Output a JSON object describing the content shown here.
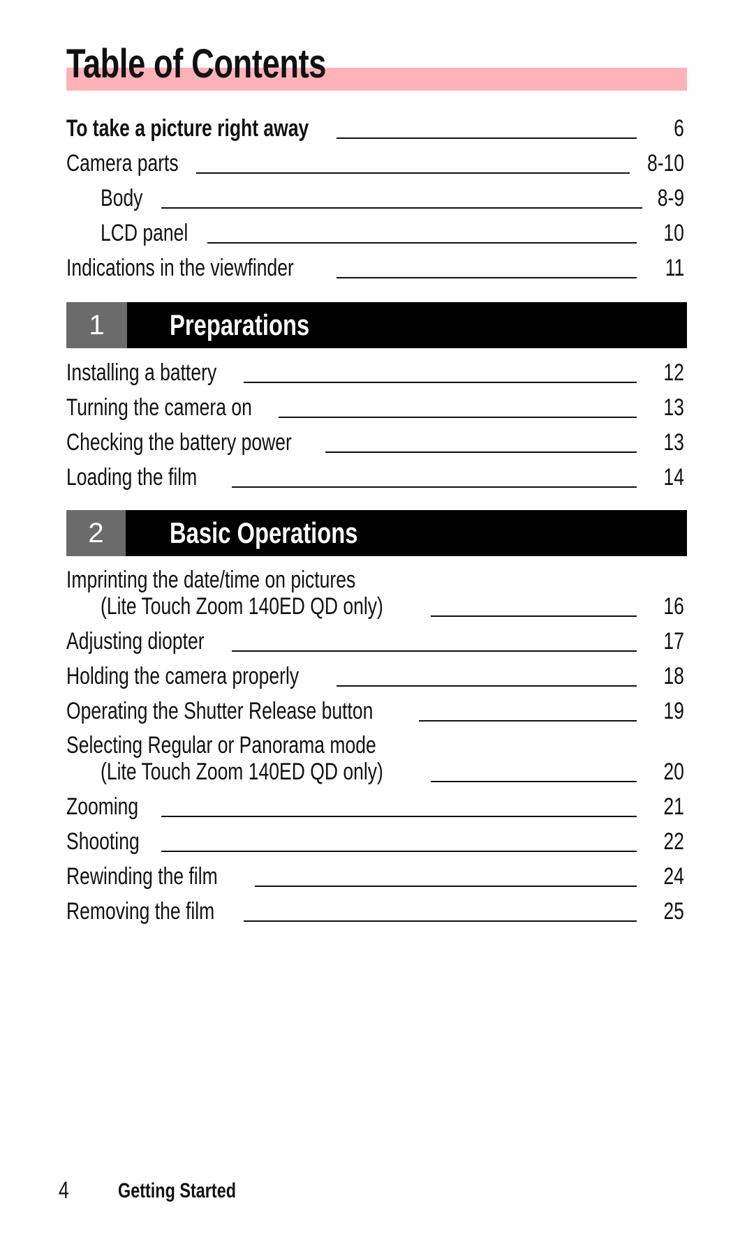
{
  "title": "Table of Contents",
  "intro_entries": [
    {
      "label": "To take a picture right away",
      "page": "6",
      "bold": true
    },
    {
      "label": "Camera parts",
      "page": "8-10"
    },
    {
      "label": "Body",
      "page": "8-9",
      "indent": true
    },
    {
      "label": "LCD panel",
      "page": "10",
      "indent": true
    },
    {
      "label": "Indications in the viewfinder",
      "page": "11"
    }
  ],
  "sections": [
    {
      "number": "1",
      "title": "Preparations",
      "entries": [
        {
          "label": "Installing a battery",
          "page": "12"
        },
        {
          "label": "Turning the camera on",
          "page": "13"
        },
        {
          "label": "Checking the battery power",
          "page": "13"
        },
        {
          "label": "Loading the film",
          "page": "14"
        }
      ]
    },
    {
      "number": "2",
      "title": "Basic Operations",
      "entries": [
        {
          "label": "Imprinting the date/time on pictures",
          "sublabel": "(Lite Touch Zoom 140ED QD only)",
          "page": "16"
        },
        {
          "label": "Adjusting diopter",
          "page": "17"
        },
        {
          "label": "Holding the camera properly",
          "page": "18"
        },
        {
          "label": "Operating the Shutter Release button",
          "page": "19"
        },
        {
          "label": "Selecting Regular or Panorama mode",
          "sublabel": "(Lite Touch Zoom 140ED QD only)",
          "page": "20"
        },
        {
          "label": "Zooming",
          "page": "21"
        },
        {
          "label": "Shooting",
          "page": "22"
        },
        {
          "label": "Rewinding the film",
          "page": "24"
        },
        {
          "label": "Removing the film",
          "page": "25"
        }
      ]
    }
  ],
  "footer": {
    "page_number": "4",
    "chapter": "Getting Started"
  },
  "colors": {
    "title_highlight": "#ffb3b8",
    "section_bar": "#000000",
    "section_number_box": "#6b6b6b"
  }
}
